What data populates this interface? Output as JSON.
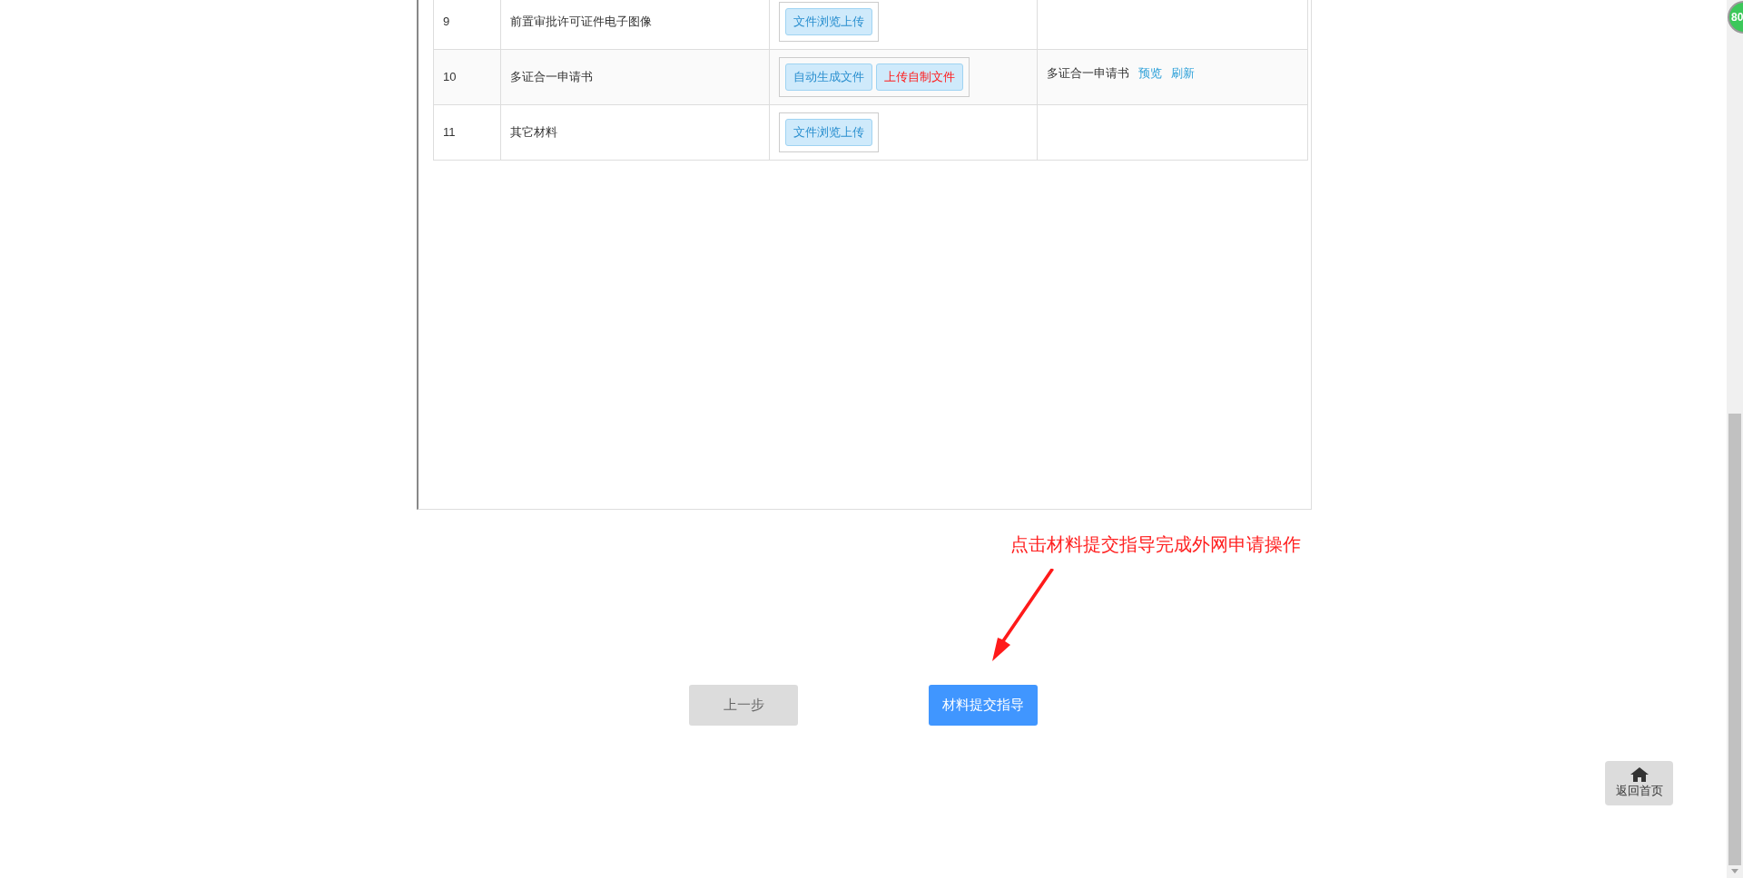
{
  "table": {
    "rows": [
      {
        "number": "9",
        "name": "前置审批许可证件电子图像",
        "actions": [
          {
            "label": "文件浏览上传",
            "kind": "normal"
          }
        ]
      },
      {
        "number": "10",
        "name": "多证合一申请书",
        "actions": [
          {
            "label": "自动生成文件",
            "kind": "normal"
          },
          {
            "label": "上传自制文件",
            "kind": "highlight"
          }
        ],
        "note": {
          "text": "多证合一申请书",
          "links": [
            "预览",
            "刷新"
          ]
        }
      },
      {
        "number": "11",
        "name": "其它材料",
        "actions": [
          {
            "label": "文件浏览上传",
            "kind": "normal"
          }
        ]
      }
    ]
  },
  "annotation": "点击材料提交指导完成外网申请操作",
  "buttons": [
    {
      "label": "上一步",
      "kind": "secondary"
    },
    {
      "label": "材料提交指导",
      "kind": "primary"
    }
  ],
  "home_button": "返回首页",
  "badge": "80"
}
